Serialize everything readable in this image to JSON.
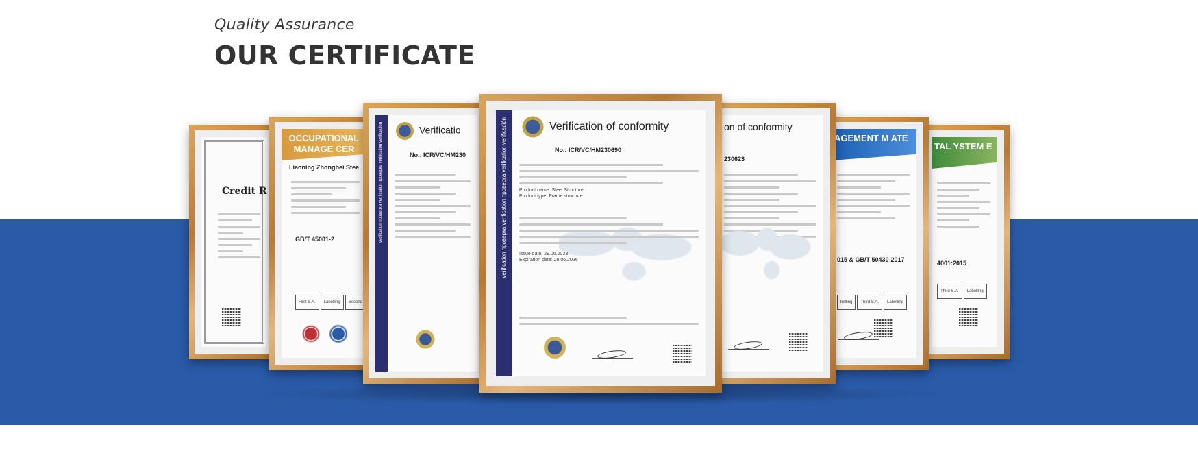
{
  "header": {
    "subtitle": "Quality Assurance",
    "title": "OUR CERTIFICATE"
  },
  "colors": {
    "band": "#2a5aa8",
    "frame_gold": "#c18a45"
  },
  "certificates": {
    "credit": {
      "title": "Credit R",
      "boxes": []
    },
    "ohs_left": {
      "banner": "OCCUPATIONAL MANAGE CER",
      "company": "Liaoning Zhongbei Stee",
      "standard": "GB/T 45001-2",
      "boxes": [
        "First S.A.",
        "Labelling",
        "Second"
      ]
    },
    "vc_left": {
      "heading": "Verificatio",
      "number": "No.: ICR/VC/HM230"
    },
    "vc_center": {
      "heading": "Verification of conformity",
      "number": "No.: ICR/VC/HM230690",
      "strip_text": "verification  проверка  verification  проверка  verification  verificación",
      "product_name": "Steel Structure",
      "product_type": "Frame structure",
      "issue_date": "29.06.2023",
      "expiry_date": "28.06.2026"
    },
    "vc_right": {
      "heading": "on of conformity",
      "number": "230623"
    },
    "ohs_blue": {
      "banner": "AGEMENT M ATE",
      "standard": "015 & GB/T 50430-2017",
      "boxes": [
        "belling",
        "Third S.A.",
        "Labelling"
      ]
    },
    "ohs_green": {
      "banner": "TAL YSTEM E",
      "standard": "4001:2015",
      "boxes": [
        "Third S.A.",
        "Labelling"
      ]
    }
  }
}
